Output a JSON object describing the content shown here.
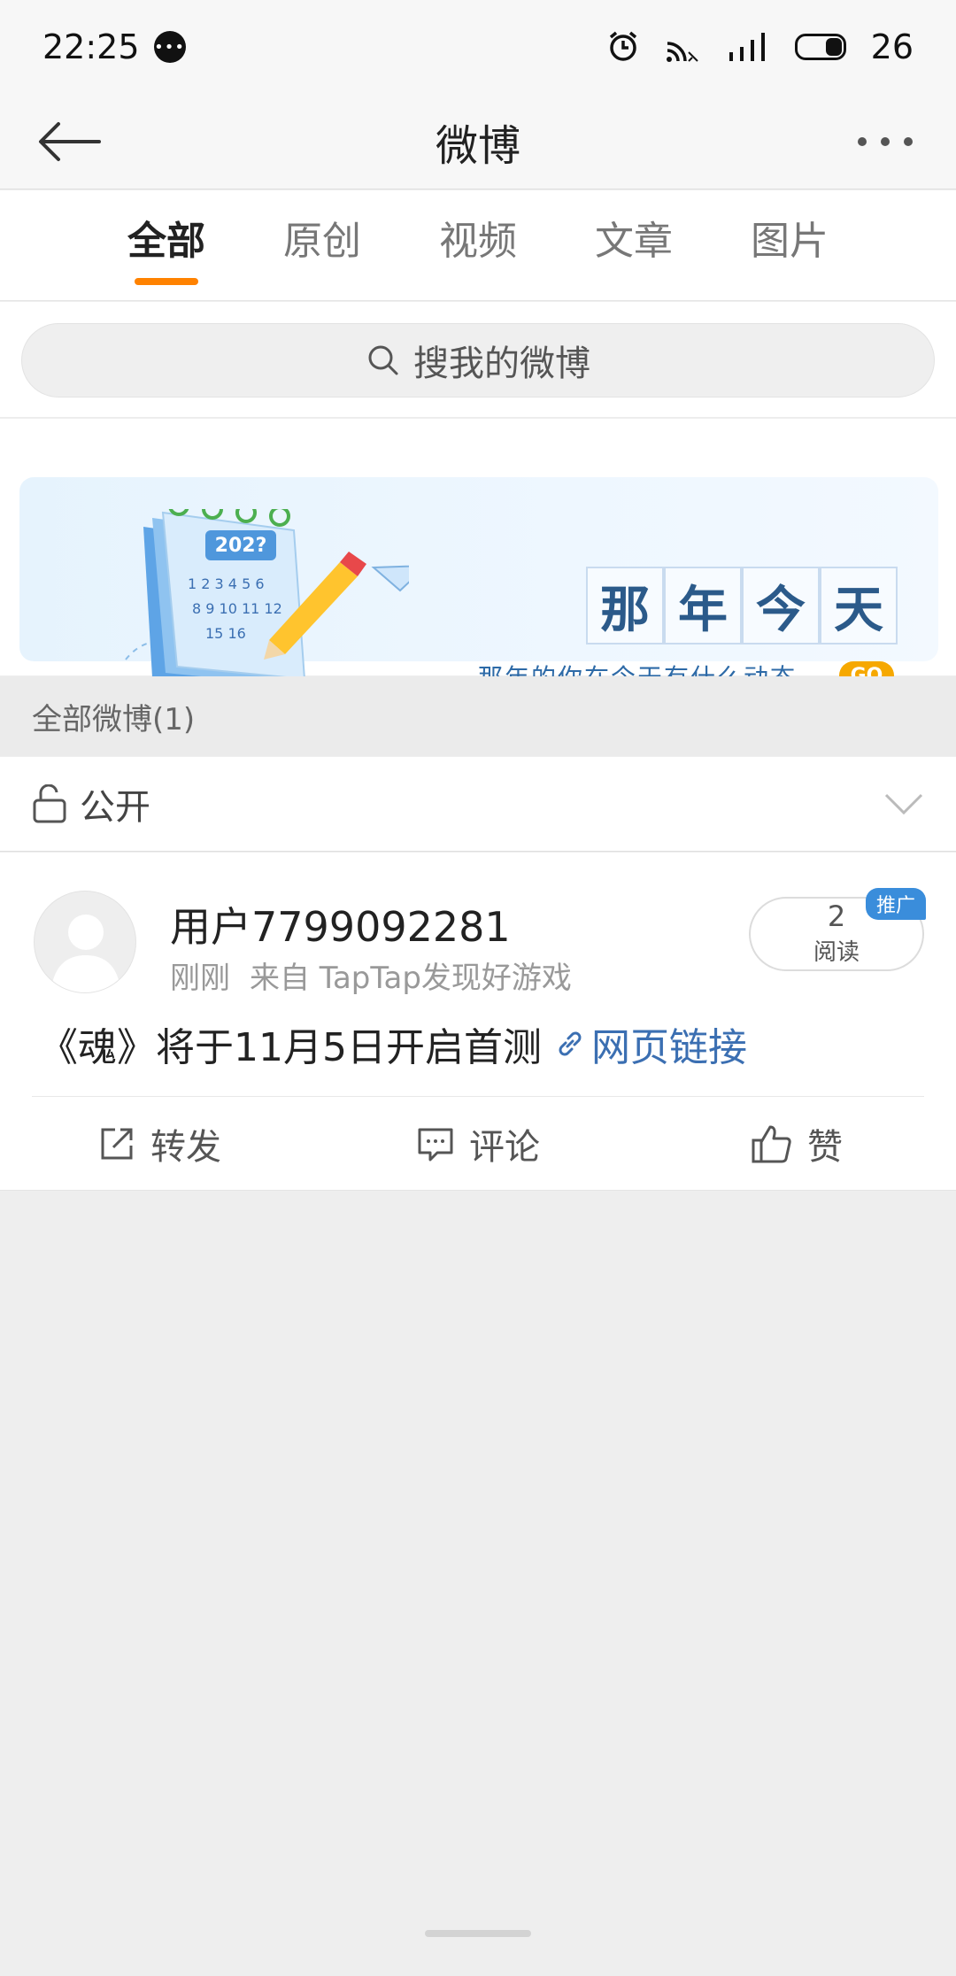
{
  "status": {
    "time": "22:25",
    "battery": "26",
    "icons": [
      "chat-icon",
      "alarm-icon",
      "cast-icon",
      "signal-icon",
      "battery-icon"
    ]
  },
  "nav": {
    "title": "微博",
    "back_icon": "back-arrow-icon",
    "more_icon": "more-icon"
  },
  "tabs": [
    {
      "label": "全部",
      "active": true
    },
    {
      "label": "原创",
      "active": false
    },
    {
      "label": "视频",
      "active": false
    },
    {
      "label": "文章",
      "active": false
    },
    {
      "label": "图片",
      "active": false
    }
  ],
  "search": {
    "placeholder": "搜我的微博"
  },
  "banner": {
    "year_art": "202?",
    "title_chars": [
      "那",
      "年",
      "今",
      "天"
    ],
    "subtitle": "那年的你在今天有什么动态",
    "go": "GO"
  },
  "section": {
    "label": "全部微博(1)"
  },
  "filter": {
    "label": "公开"
  },
  "post": {
    "username": "用户7799092281",
    "time": "刚刚",
    "source": "来自 TapTap发现好游戏",
    "reads": "2",
    "reads_label": "阅读",
    "badge": "推广",
    "text": "《魂》将于11月5日开启首测",
    "link": "网页链接"
  },
  "actions": {
    "repost": "转发",
    "comment": "评论",
    "like": "赞"
  },
  "colors": {
    "accent": "#ff8200",
    "link": "#3b6fb2",
    "badge": "#3a8ddb"
  }
}
